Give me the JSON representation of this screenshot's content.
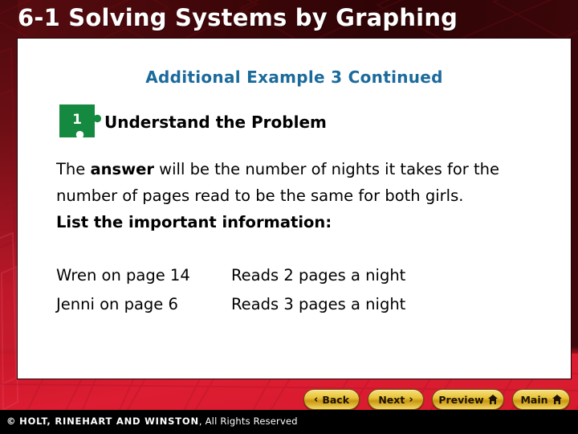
{
  "slide": {
    "title": "6-1  Solving Systems by Graphing",
    "subtitle": "Additional Example 3 Continued"
  },
  "step": {
    "number": "1",
    "label": "Understand the Problem"
  },
  "body": {
    "line1_pre": "The  ",
    "line1_bold": "answer",
    "line1_post": " will be the number of nights it takes for the number of pages read to be the same for both girls.",
    "line2_bold": "List the important information:"
  },
  "facts": [
    {
      "who": "Wren on page 14",
      "rate": "Reads 2 pages a night"
    },
    {
      "who": "Jenni on page 6",
      "rate": "Reads 3 pages a night"
    }
  ],
  "nav": {
    "back": "Back",
    "next": "Next",
    "preview": "Preview",
    "main": "Main",
    "back_chevron": "‹",
    "next_chevron": "›",
    "home_icon_name": "home-icon"
  },
  "footer": {
    "copyright_symbol": "©",
    "publisher": "HOLT, RINEHART AND WINSTON",
    "rights": ", All Rights Reserved"
  },
  "colors": {
    "frame_dark": "#3d0609",
    "frame_red": "#d31f31",
    "panel_bg": "#ffffff",
    "subtitle_blue": "#1b6a9c",
    "puzzle_green": "#15893f",
    "button_gold": "#e8c23a",
    "footer_bg": "#000000"
  }
}
